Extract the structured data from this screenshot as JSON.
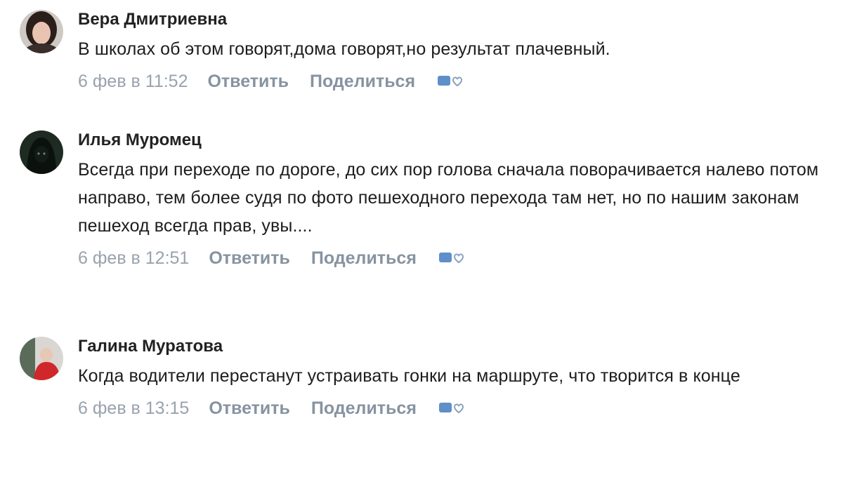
{
  "comments": [
    {
      "author": "Вера Дмитриевна",
      "text": "В школах об этом говорят,дома говорят,но результат плачевный.",
      "date": "6 фев в 11:52",
      "reply_label": "Ответить",
      "share_label": "Поделиться",
      "avatar_icon": "user-photo-woman"
    },
    {
      "author": "Илья Муромец",
      "text": "Всегда при переходе по дороге, до сих пор голова сначала поворачивается налево потом направо, тем более судя по фото пешеходного перехода там нет, но по нашим законам пешеход всегда прав, увы....",
      "date": "6 фев в 12:51",
      "reply_label": "Ответить",
      "share_label": "Поделиться",
      "avatar_icon": "user-photo-hooded-figure"
    },
    {
      "author": "Галина Муратова",
      "text": "Когда водители перестанут устраивать гонки на маршруте, что творится в конце",
      "date": "6 фев в 13:15",
      "reply_label": "Ответить",
      "share_label": "Поделиться",
      "avatar_icon": "user-photo-woman-red"
    }
  ],
  "like_icon": "like-heart-icon"
}
